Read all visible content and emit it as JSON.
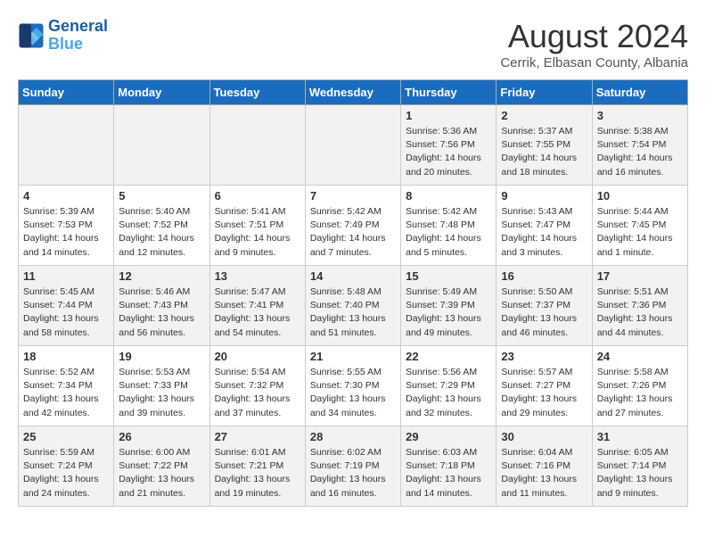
{
  "header": {
    "logo_line1": "General",
    "logo_line2": "Blue",
    "month_year": "August 2024",
    "subtitle": "Cerrik, Elbasan County, Albania"
  },
  "days_of_week": [
    "Sunday",
    "Monday",
    "Tuesday",
    "Wednesday",
    "Thursday",
    "Friday",
    "Saturday"
  ],
  "weeks": [
    [
      {
        "day": "",
        "info": ""
      },
      {
        "day": "",
        "info": ""
      },
      {
        "day": "",
        "info": ""
      },
      {
        "day": "",
        "info": ""
      },
      {
        "day": "1",
        "info": "Sunrise: 5:36 AM\nSunset: 7:56 PM\nDaylight: 14 hours\nand 20 minutes."
      },
      {
        "day": "2",
        "info": "Sunrise: 5:37 AM\nSunset: 7:55 PM\nDaylight: 14 hours\nand 18 minutes."
      },
      {
        "day": "3",
        "info": "Sunrise: 5:38 AM\nSunset: 7:54 PM\nDaylight: 14 hours\nand 16 minutes."
      }
    ],
    [
      {
        "day": "4",
        "info": "Sunrise: 5:39 AM\nSunset: 7:53 PM\nDaylight: 14 hours\nand 14 minutes."
      },
      {
        "day": "5",
        "info": "Sunrise: 5:40 AM\nSunset: 7:52 PM\nDaylight: 14 hours\nand 12 minutes."
      },
      {
        "day": "6",
        "info": "Sunrise: 5:41 AM\nSunset: 7:51 PM\nDaylight: 14 hours\nand 9 minutes."
      },
      {
        "day": "7",
        "info": "Sunrise: 5:42 AM\nSunset: 7:49 PM\nDaylight: 14 hours\nand 7 minutes."
      },
      {
        "day": "8",
        "info": "Sunrise: 5:42 AM\nSunset: 7:48 PM\nDaylight: 14 hours\nand 5 minutes."
      },
      {
        "day": "9",
        "info": "Sunrise: 5:43 AM\nSunset: 7:47 PM\nDaylight: 14 hours\nand 3 minutes."
      },
      {
        "day": "10",
        "info": "Sunrise: 5:44 AM\nSunset: 7:45 PM\nDaylight: 14 hours\nand 1 minute."
      }
    ],
    [
      {
        "day": "11",
        "info": "Sunrise: 5:45 AM\nSunset: 7:44 PM\nDaylight: 13 hours\nand 58 minutes."
      },
      {
        "day": "12",
        "info": "Sunrise: 5:46 AM\nSunset: 7:43 PM\nDaylight: 13 hours\nand 56 minutes."
      },
      {
        "day": "13",
        "info": "Sunrise: 5:47 AM\nSunset: 7:41 PM\nDaylight: 13 hours\nand 54 minutes."
      },
      {
        "day": "14",
        "info": "Sunrise: 5:48 AM\nSunset: 7:40 PM\nDaylight: 13 hours\nand 51 minutes."
      },
      {
        "day": "15",
        "info": "Sunrise: 5:49 AM\nSunset: 7:39 PM\nDaylight: 13 hours\nand 49 minutes."
      },
      {
        "day": "16",
        "info": "Sunrise: 5:50 AM\nSunset: 7:37 PM\nDaylight: 13 hours\nand 46 minutes."
      },
      {
        "day": "17",
        "info": "Sunrise: 5:51 AM\nSunset: 7:36 PM\nDaylight: 13 hours\nand 44 minutes."
      }
    ],
    [
      {
        "day": "18",
        "info": "Sunrise: 5:52 AM\nSunset: 7:34 PM\nDaylight: 13 hours\nand 42 minutes."
      },
      {
        "day": "19",
        "info": "Sunrise: 5:53 AM\nSunset: 7:33 PM\nDaylight: 13 hours\nand 39 minutes."
      },
      {
        "day": "20",
        "info": "Sunrise: 5:54 AM\nSunset: 7:32 PM\nDaylight: 13 hours\nand 37 minutes."
      },
      {
        "day": "21",
        "info": "Sunrise: 5:55 AM\nSunset: 7:30 PM\nDaylight: 13 hours\nand 34 minutes."
      },
      {
        "day": "22",
        "info": "Sunrise: 5:56 AM\nSunset: 7:29 PM\nDaylight: 13 hours\nand 32 minutes."
      },
      {
        "day": "23",
        "info": "Sunrise: 5:57 AM\nSunset: 7:27 PM\nDaylight: 13 hours\nand 29 minutes."
      },
      {
        "day": "24",
        "info": "Sunrise: 5:58 AM\nSunset: 7:26 PM\nDaylight: 13 hours\nand 27 minutes."
      }
    ],
    [
      {
        "day": "25",
        "info": "Sunrise: 5:59 AM\nSunset: 7:24 PM\nDaylight: 13 hours\nand 24 minutes."
      },
      {
        "day": "26",
        "info": "Sunrise: 6:00 AM\nSunset: 7:22 PM\nDaylight: 13 hours\nand 21 minutes."
      },
      {
        "day": "27",
        "info": "Sunrise: 6:01 AM\nSunset: 7:21 PM\nDaylight: 13 hours\nand 19 minutes."
      },
      {
        "day": "28",
        "info": "Sunrise: 6:02 AM\nSunset: 7:19 PM\nDaylight: 13 hours\nand 16 minutes."
      },
      {
        "day": "29",
        "info": "Sunrise: 6:03 AM\nSunset: 7:18 PM\nDaylight: 13 hours\nand 14 minutes."
      },
      {
        "day": "30",
        "info": "Sunrise: 6:04 AM\nSunset: 7:16 PM\nDaylight: 13 hours\nand 11 minutes."
      },
      {
        "day": "31",
        "info": "Sunrise: 6:05 AM\nSunset: 7:14 PM\nDaylight: 13 hours\nand 9 minutes."
      }
    ]
  ]
}
